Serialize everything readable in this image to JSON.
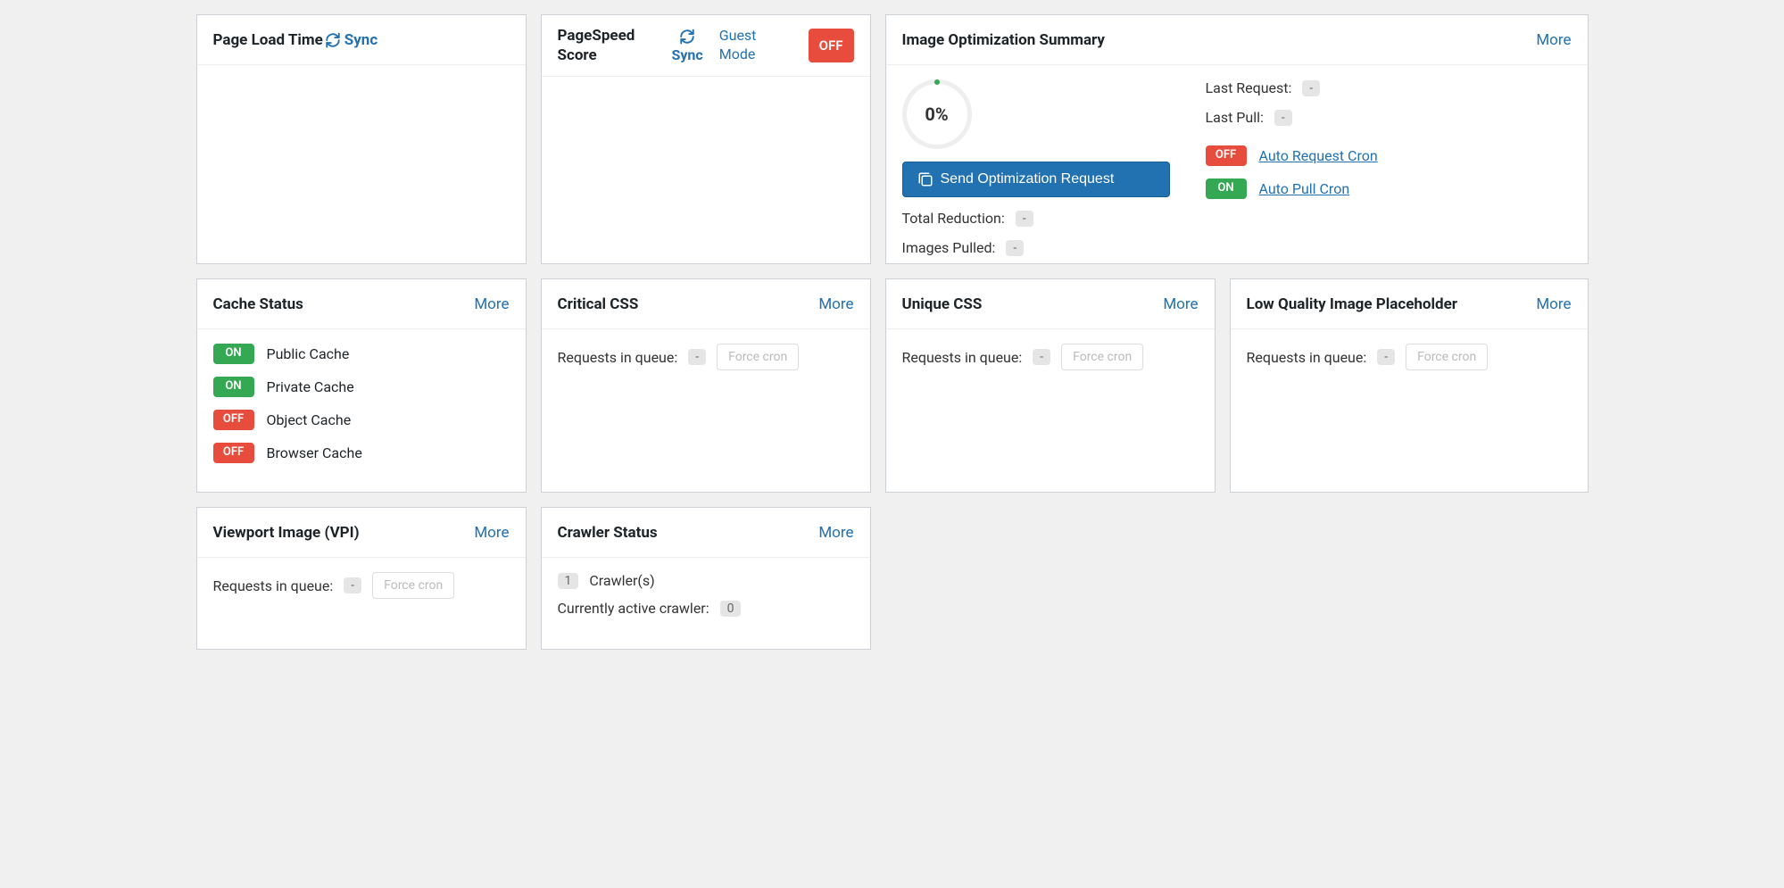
{
  "labels": {
    "sync": "Sync",
    "guest_mode": "Guest Mode",
    "more": "More",
    "force_cron": "Force cron",
    "requests_in_queue": "Requests in queue:"
  },
  "page_load_time": {
    "title": "Page Load Time"
  },
  "pagespeed": {
    "title": "PageSpeed Score",
    "off": "OFF"
  },
  "image_opt": {
    "title": "Image Optimization Summary",
    "gauge": "0%",
    "send_button": "Send Optimization Request",
    "total_reduction_label": "Total Reduction:",
    "total_reduction_value": "-",
    "images_pulled_label": "Images Pulled:",
    "images_pulled_value": "-",
    "last_request_label": "Last Request:",
    "last_request_value": "-",
    "last_pull_label": "Last Pull:",
    "last_pull_value": "-",
    "auto_request_cron": "Auto Request Cron",
    "auto_request_cron_badge": "OFF",
    "auto_pull_cron": "Auto Pull Cron",
    "auto_pull_cron_badge": "ON"
  },
  "cache_status": {
    "title": "Cache Status",
    "items": [
      {
        "state": "ON",
        "label": "Public Cache"
      },
      {
        "state": "ON",
        "label": "Private Cache"
      },
      {
        "state": "OFF",
        "label": "Object Cache"
      },
      {
        "state": "OFF",
        "label": "Browser Cache"
      }
    ]
  },
  "critical_css": {
    "title": "Critical CSS",
    "queue": "-"
  },
  "unique_css": {
    "title": "Unique CSS",
    "queue": "-"
  },
  "lqip": {
    "title": "Low Quality Image Placeholder",
    "queue": "-"
  },
  "vpi": {
    "title": "Viewport Image (VPI)",
    "queue": "-"
  },
  "crawler": {
    "title": "Crawler Status",
    "count": "1",
    "count_suffix": "Crawler(s)",
    "active_label": "Currently active crawler:",
    "active_value": "0"
  }
}
